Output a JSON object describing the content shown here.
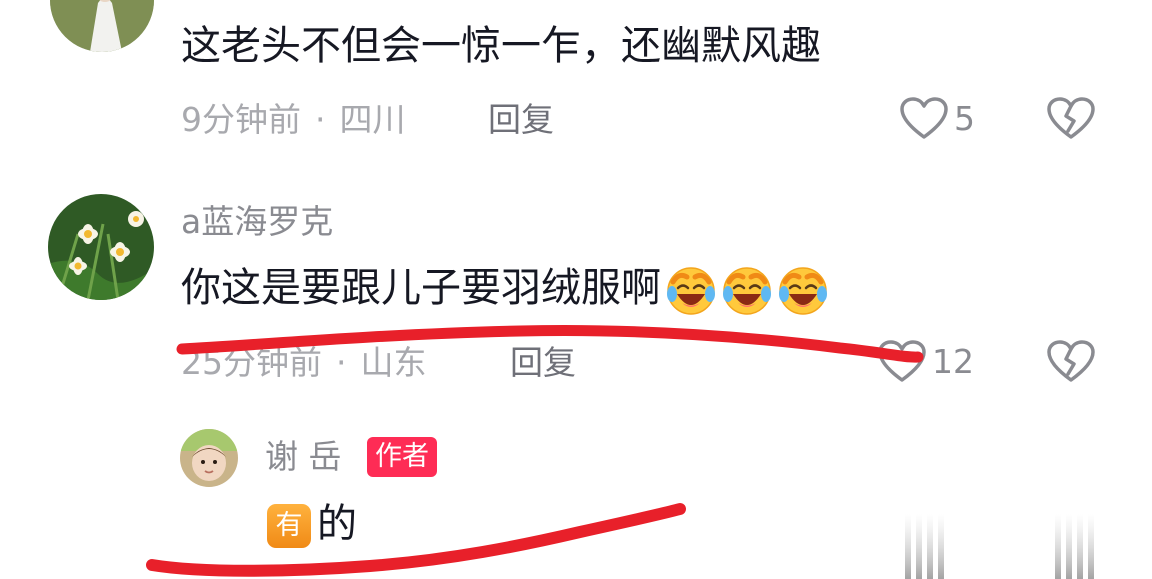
{
  "colors": {
    "text": "#161823",
    "meta": "#a8a9ae",
    "author_badge": "#fe2c55",
    "annotation": "#e8202a"
  },
  "comments": [
    {
      "text": "这老头不但会一惊一乍，还幽默风趣",
      "time": "9分钟前",
      "separator": "·",
      "location": "四川",
      "reply_label": "回复",
      "likes": "5",
      "avatar_icon": "woman-photo-avatar"
    },
    {
      "username": "a蓝海罗克",
      "text": "你这是要跟儿子要羽绒服啊",
      "emoji_icon": "laughing-crying-emoji",
      "emoji_count": 3,
      "time": "25分钟前",
      "separator": "·",
      "location": "山东",
      "reply_label": "回复",
      "likes": "12",
      "avatar_icon": "daffodil-flower-avatar"
    }
  ],
  "reply": {
    "username": "谢 岳",
    "badge": "作者",
    "have_badge": "有",
    "text": "的",
    "avatar_icon": "baby-photo-avatar"
  },
  "icons": {
    "like": "heart-outline-icon",
    "dislike": "broken-heart-icon"
  }
}
